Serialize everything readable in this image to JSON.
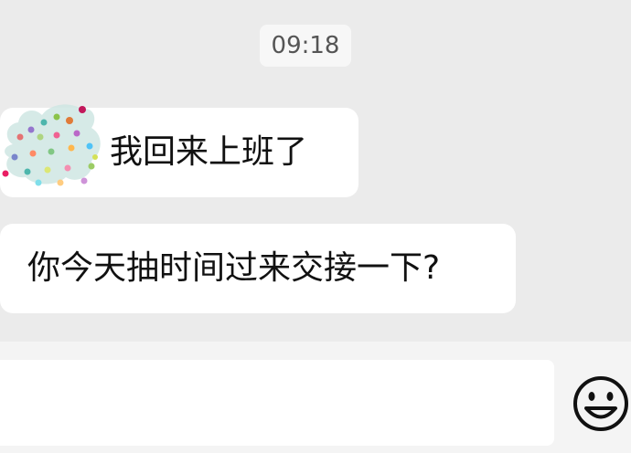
{
  "chat": {
    "time_divider": "09:18",
    "messages": [
      {
        "text": "我回来上班了",
        "has_sticker": true
      },
      {
        "text": "你今天抽时间过来交接一下?"
      }
    ]
  },
  "input": {
    "value": "",
    "emoji_icon": "smiley-face-icon"
  },
  "colors": {
    "chat_background": "#ebebeb",
    "bubble": "#ffffff",
    "input_bar": "#f4f4f4"
  }
}
